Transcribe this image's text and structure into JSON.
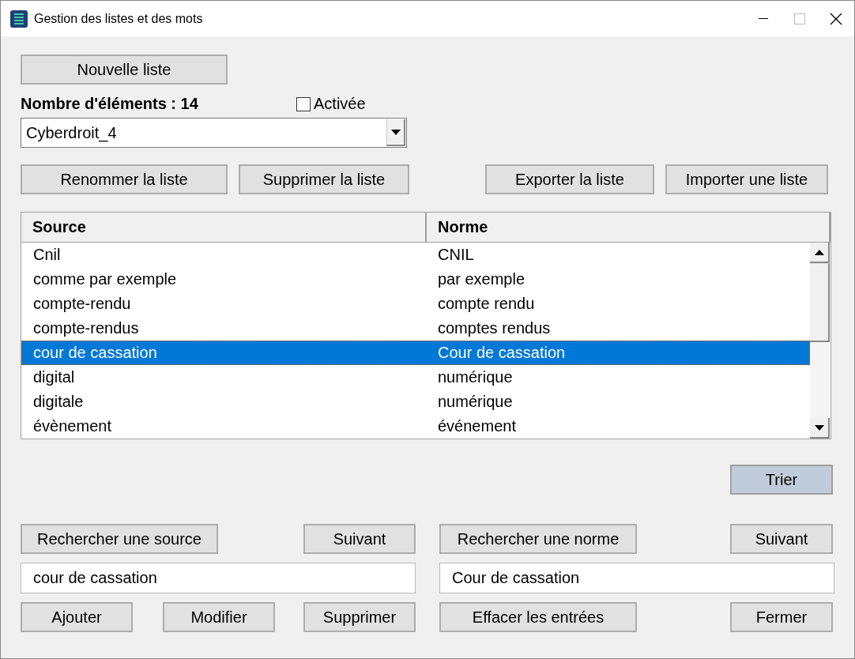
{
  "window": {
    "title": "Gestion des listes et des mots"
  },
  "new_list_button": "Nouvelle liste",
  "count_label": "Nombre d'éléments : 14",
  "activated": {
    "label": "Activée",
    "checked": false
  },
  "list_combo": {
    "value": "Cyberdroit_4"
  },
  "list_buttons": {
    "rename": "Renommer la liste",
    "delete": "Supprimer la liste",
    "export": "Exporter la liste",
    "import": "Importer une liste"
  },
  "table": {
    "columns": [
      "Source",
      "Norme"
    ],
    "rows": [
      {
        "source": "Cnil",
        "norme": "CNIL",
        "selected": false
      },
      {
        "source": "comme par exemple",
        "norme": "par exemple",
        "selected": false
      },
      {
        "source": "compte-rendu",
        "norme": "compte rendu",
        "selected": false
      },
      {
        "source": "compte-rendus",
        "norme": "comptes rendus",
        "selected": false
      },
      {
        "source": "cour de cassation",
        "norme": "Cour de cassation",
        "selected": true
      },
      {
        "source": "digital",
        "norme": "numérique",
        "selected": false
      },
      {
        "source": "digitale",
        "norme": "numérique",
        "selected": false
      },
      {
        "source": "évènement",
        "norme": "événement",
        "selected": false
      }
    ]
  },
  "sort_button": {
    "label": "Trier",
    "highlighted": true
  },
  "search": {
    "source_button": "Rechercher une source",
    "source_next": "Suivant",
    "norme_button": "Rechercher une norme",
    "norme_next": "Suivant"
  },
  "fields": {
    "source": "cour de cassation",
    "norme": "Cour de cassation"
  },
  "bottom_buttons": {
    "add": "Ajouter",
    "modify": "Modifier",
    "delete": "Supprimer",
    "clear": "Effacer les entrées",
    "close": "Fermer"
  }
}
